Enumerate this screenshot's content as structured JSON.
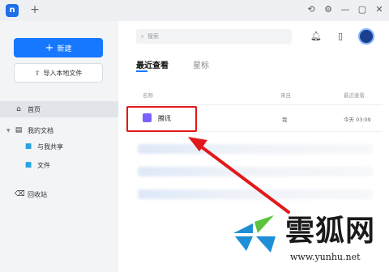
{
  "window": {
    "logo_label": "n",
    "new_tab_label": "+",
    "controls": [
      "⟲",
      "⚙",
      "—",
      "▢",
      "✕"
    ]
  },
  "sidebar": {
    "new_button": "新建",
    "import_button": "导入本地文件",
    "items": [
      {
        "label": "首页",
        "icon": "home-icon"
      },
      {
        "label": "我的文档",
        "icon": "doc-icon"
      },
      {
        "label": "与我共享",
        "icon": "shared-folder-icon"
      },
      {
        "label": "文件",
        "icon": "folder-icon"
      },
      {
        "label": "回收站",
        "icon": "trash-icon"
      }
    ]
  },
  "main": {
    "search_placeholder": "搜索",
    "tabs": [
      "最近查看",
      "星标"
    ],
    "columns": {
      "name": "名称",
      "source": "来自",
      "time": "最近查看"
    },
    "rows": [
      {
        "name": "腾讯",
        "source": "我",
        "time": "今天 03:09"
      }
    ]
  },
  "watermark": {
    "text": "雲狐网",
    "url": "www.yunhu.net"
  },
  "colors": {
    "accent": "#1677ff",
    "annotation": "#e0191a",
    "file_icon": "#7b61ff"
  }
}
